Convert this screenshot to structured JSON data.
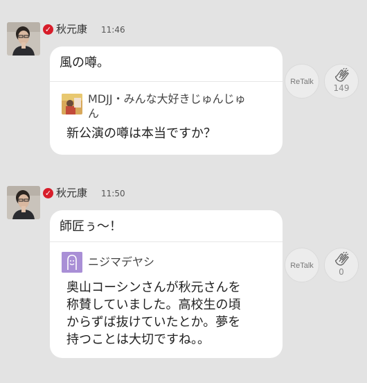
{
  "posts": [
    {
      "author": "秋元康",
      "time": "11:46",
      "message": "風の噂。",
      "quote": {
        "name_line1": "MDJJ・みんな大好きじゅんじゅ",
        "name_line2": "ん",
        "lines": [
          "新公演の噂は本当ですか？"
        ]
      },
      "retalk_label": "ReTalk",
      "clap_count": "149"
    },
    {
      "author": "秋元康",
      "time": "11:50",
      "message": "師匠ぅ～！",
      "quote": {
        "name_line1": "ニジマデヤシ",
        "lines": [
          "奥山コーシンさんが秋元さんを",
          "称賛していました。高校生の頃",
          "からずば抜けていたとか。夢を",
          "持つことは大切ですね。。"
        ]
      },
      "retalk_label": "ReTalk",
      "clap_count": "0"
    }
  ],
  "colors": {
    "background": "#e3e3e3",
    "verified": "#d71d2a",
    "card": "#ffffff",
    "quote_avatar_bg": "#a98fd6"
  },
  "icons": {
    "verified": "check-badge-icon",
    "clap": "clapping-hands-icon",
    "quote_default_avatar": "smiley-face-icon"
  }
}
